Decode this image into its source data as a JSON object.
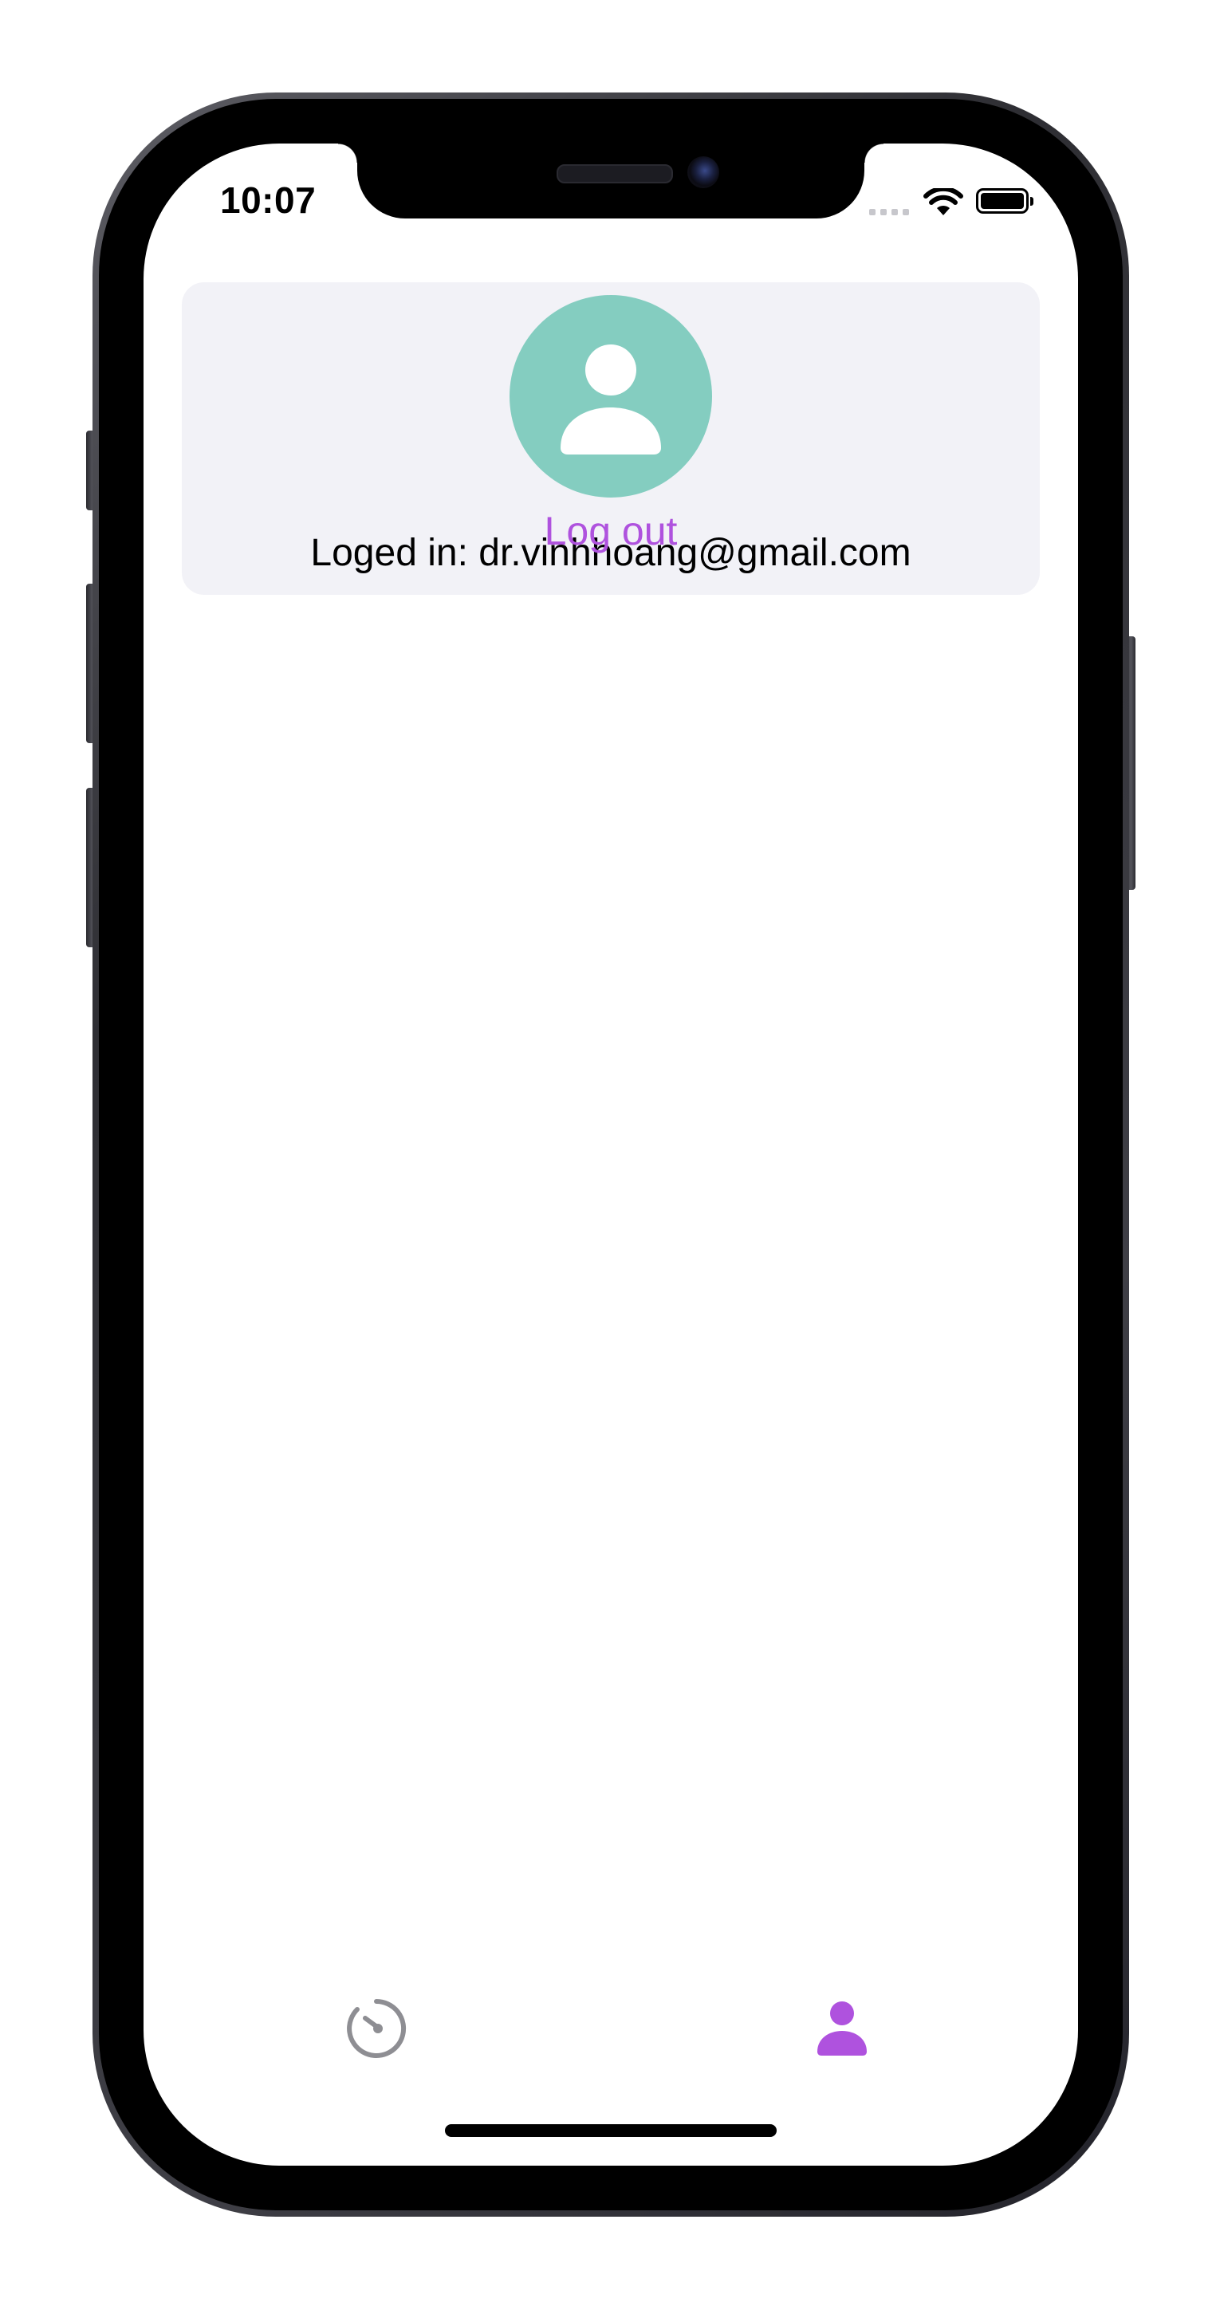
{
  "status_bar": {
    "time": "10:07"
  },
  "profile": {
    "avatar_icon": "person-icon",
    "login_text": "Loged in: dr.vinhhoang@gmail.com"
  },
  "actions": {
    "logout_label": "Log out"
  },
  "tab_bar": {
    "tabs": [
      {
        "icon": "speedometer-icon",
        "selected": false
      },
      {
        "icon": "person-fill-icon",
        "selected": true
      }
    ]
  },
  "colors": {
    "accent": "#af52de",
    "avatar_background": "#84cdc0",
    "card_background": "#f2f2f7",
    "inactive_tab": "#8e8e93"
  }
}
